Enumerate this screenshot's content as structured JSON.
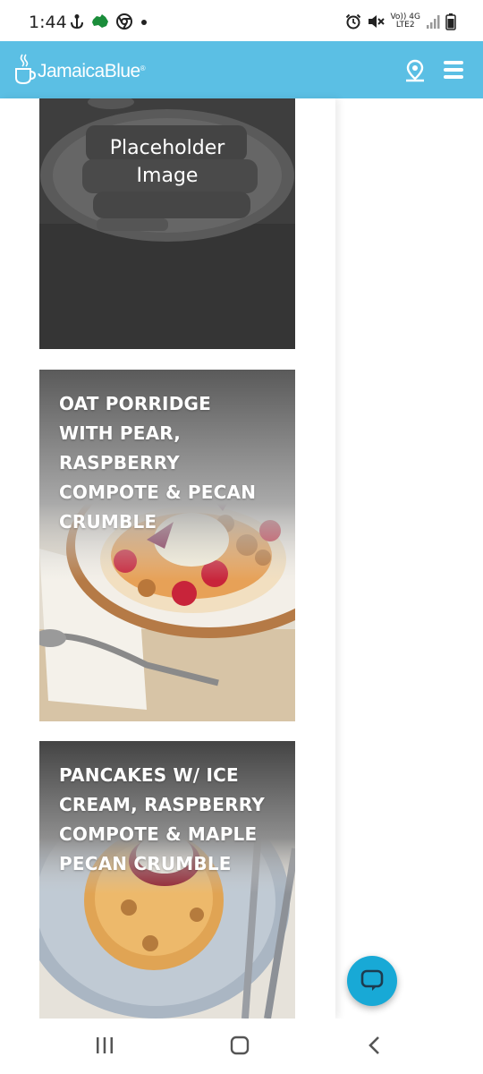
{
  "status_bar": {
    "time": "1:44",
    "network_top": "Vo)) 4G",
    "network_bottom": "LTE2",
    "icons": [
      "anchor-icon",
      "australia-map-icon",
      "chrome-icon",
      "dot-icon",
      "alarm-icon",
      "mute-icon",
      "signal-icon",
      "battery-icon"
    ]
  },
  "header": {
    "brand": "JamaicaBlue",
    "brand_mark": "®",
    "icons": [
      "coffee-cup-logo-icon",
      "location-pin-icon",
      "hamburger-menu-icon"
    ]
  },
  "menu_cards": [
    {
      "title": "Placeholder Image",
      "kind": "placeholder"
    },
    {
      "title": "OAT PORRIDGE WITH PEAR, RASPBERRY COMPOTE & PECAN CRUMBLE",
      "kind": "photo"
    },
    {
      "title": "PANCAKES W/ ICE CREAM, RASPBERRY COMPOTE & MAPLE PECAN CRUMBLE",
      "kind": "photo"
    }
  ],
  "chat": {
    "icon": "chat-bubble-icon"
  },
  "nav_bar": {
    "icons": [
      "recent-apps-icon",
      "home-icon",
      "back-icon"
    ]
  },
  "colors": {
    "header_bg": "#5bbfe4",
    "chat_button": "#18a9d6",
    "card_text": "#ffffff"
  }
}
